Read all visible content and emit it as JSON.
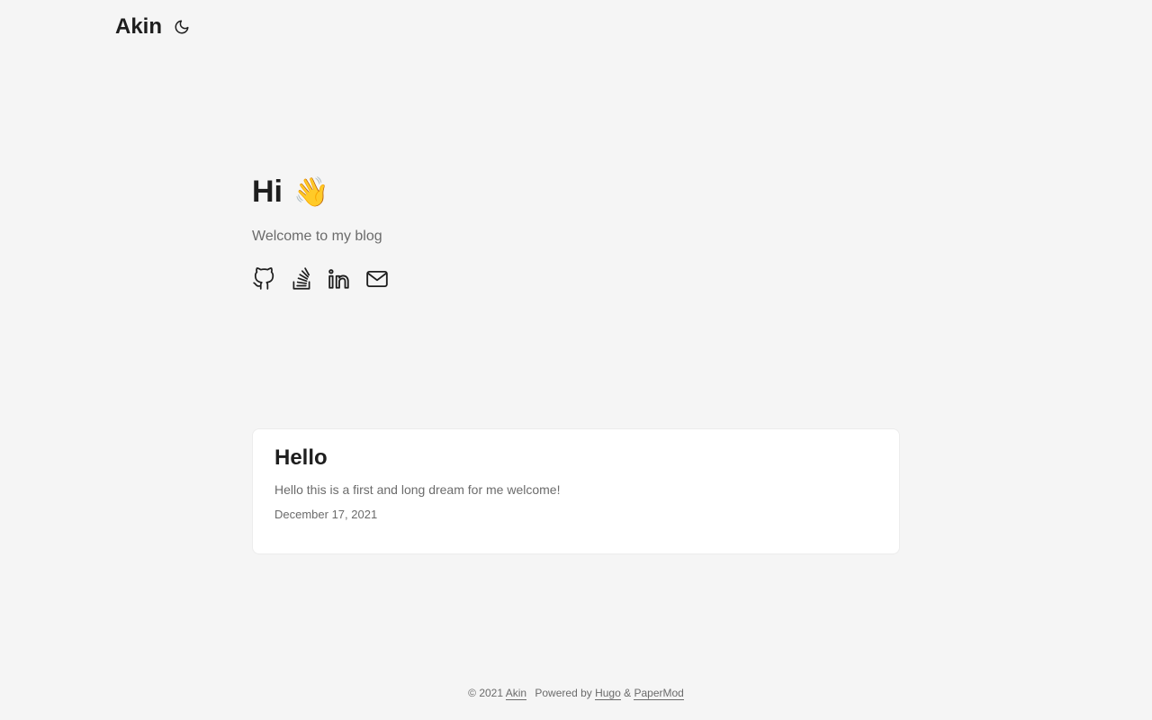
{
  "header": {
    "logo": "Akin",
    "theme_toggle_icon": "moon-icon"
  },
  "home": {
    "title": "Hi",
    "title_emoji": "👋",
    "subtitle": "Welcome to my blog",
    "social": [
      {
        "icon": "github-icon"
      },
      {
        "icon": "stackoverflow-icon"
      },
      {
        "icon": "linkedin-icon"
      },
      {
        "icon": "email-icon"
      }
    ]
  },
  "posts": [
    {
      "title": "Hello",
      "summary": "Hello this is a first and long dream for me welcome!",
      "date": "December 17, 2021"
    }
  ],
  "footer": {
    "copyright": "© 2021",
    "author_link": "Akin",
    "powered_by": "Powered by",
    "hugo_link": "Hugo",
    "ampersand": "&",
    "papermod_link": "PaperMod"
  },
  "colors": {
    "background": "#f5f5f5",
    "card": "#ffffff",
    "primary_text": "#1e1e1e",
    "secondary_text": "#6b6b6b"
  }
}
